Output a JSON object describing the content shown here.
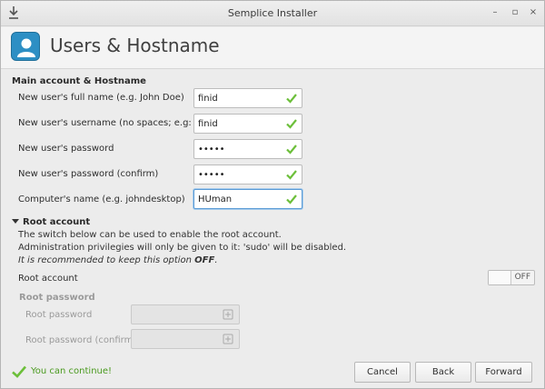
{
  "window": {
    "title": "Semplice Installer",
    "controls": {
      "minimize": "–",
      "maximize": "▫",
      "close": "×"
    }
  },
  "header": {
    "title": "Users & Hostname",
    "icon": "user-icon"
  },
  "main_section": {
    "title": "Main account & Hostname",
    "fields": [
      {
        "label": "New user's full name (e.g. John Doe)",
        "value": "finid"
      },
      {
        "label": "New user's username (no spaces; e.g: john)",
        "value": "finid"
      },
      {
        "label": "New user's password",
        "value": "•••••"
      },
      {
        "label": "New user's password (confirm)",
        "value": "•••••"
      },
      {
        "label": "Computer's name (e.g. johndesktop)",
        "value": "HUman"
      }
    ]
  },
  "root_section": {
    "title": "Root account",
    "desc1": "The switch below can be used to enable the root account.",
    "desc2": "Administration privilegies will only be given to it: 'sudo' will be disabled.",
    "desc3_prefix": "It is recommended to keep this option ",
    "desc3_emph": "OFF",
    "desc3_suffix": ".",
    "toggle_label": "Root account",
    "toggle_state": "OFF",
    "password_title": "Root password",
    "password_fields": [
      {
        "label": "Root password"
      },
      {
        "label": "Root password (confirm)"
      }
    ]
  },
  "footer": {
    "status": "You can continue!",
    "cancel": "Cancel",
    "back": "Back",
    "forward": "Forward"
  },
  "colors": {
    "accent": "#2d8fc4",
    "success": "#6cbf3a",
    "status_text": "#4a9a1f"
  }
}
